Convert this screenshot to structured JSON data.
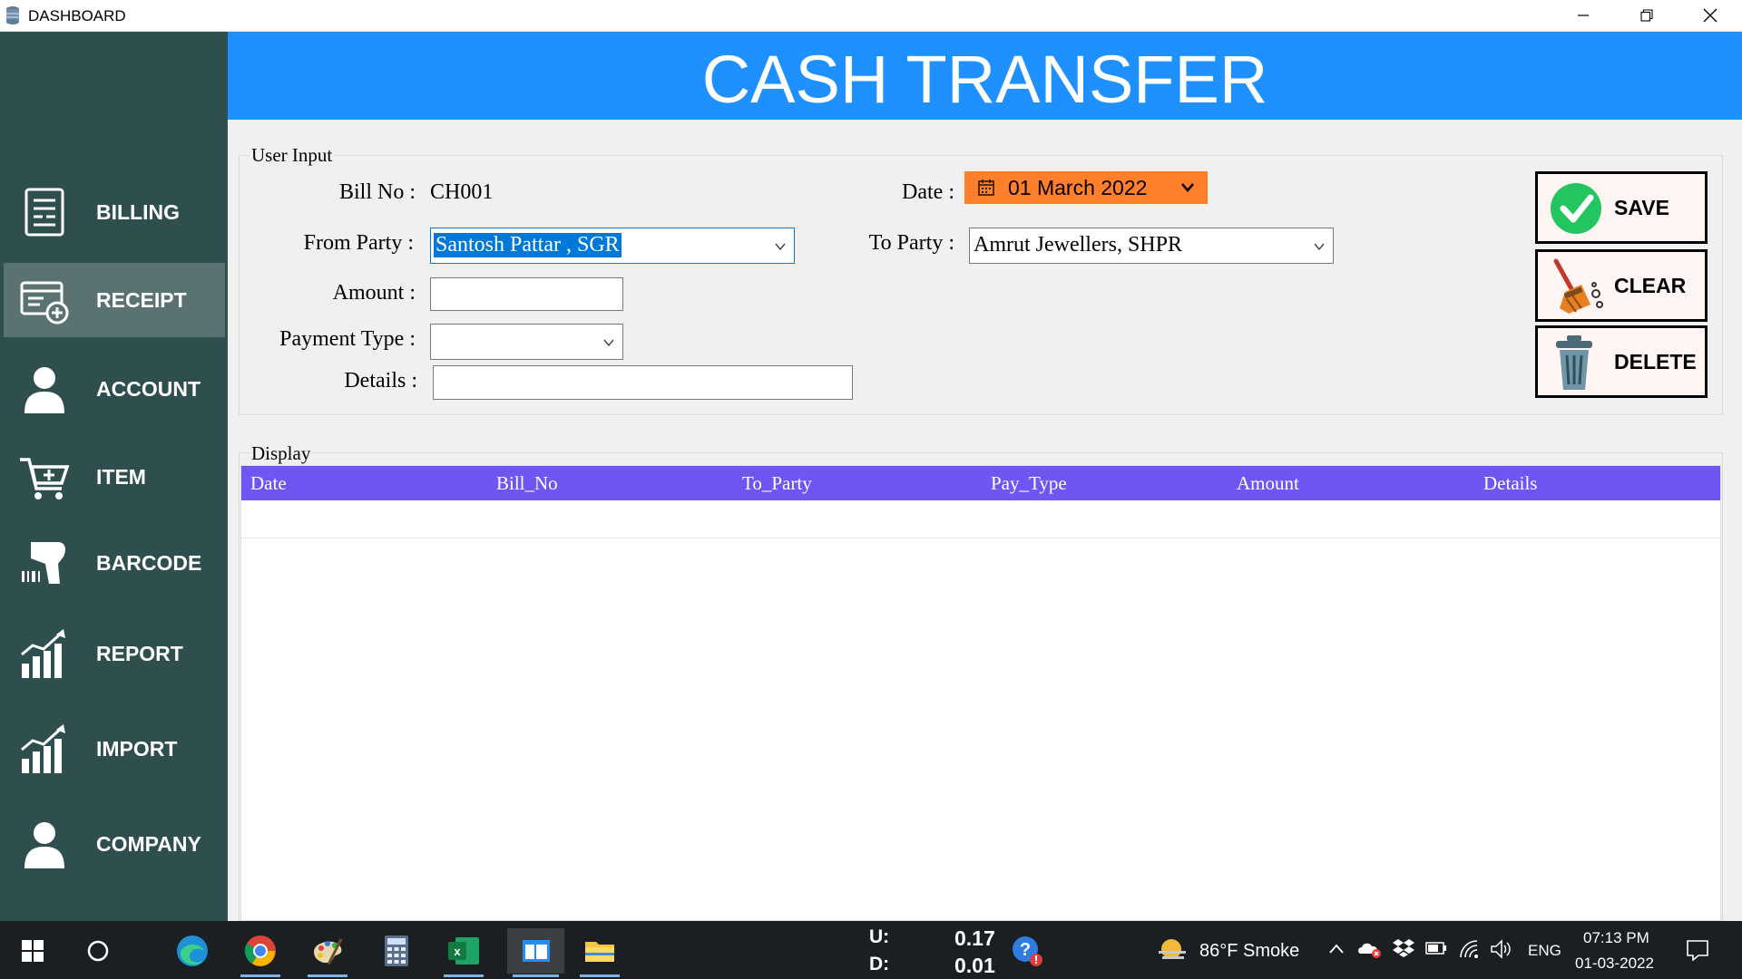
{
  "window": {
    "title": "DASHBOARD",
    "minimize_icon": "minimize-icon",
    "restore_icon": "restore-icon",
    "close_icon": "close-icon"
  },
  "sidebar": {
    "items": [
      {
        "label": "BILLING",
        "icon": "billing-icon",
        "active": false
      },
      {
        "label": "RECEIPT",
        "icon": "receipt-icon",
        "active": true
      },
      {
        "label": "ACCOUNT",
        "icon": "account-icon",
        "active": false
      },
      {
        "label": "ITEM",
        "icon": "cart-icon",
        "active": false
      },
      {
        "label": "BARCODE",
        "icon": "barcode-scanner-icon",
        "active": false
      },
      {
        "label": "REPORT",
        "icon": "report-chart-icon",
        "active": false
      },
      {
        "label": "IMPORT",
        "icon": "import-chart-icon",
        "active": false
      },
      {
        "label": "COMPANY",
        "icon": "company-icon",
        "active": false
      }
    ]
  },
  "header": {
    "title": "CASH TRANSFER"
  },
  "form": {
    "group_title": "User Input",
    "bill_no_label": "Bill No :",
    "bill_no_value": "CH001",
    "date_label": "Date :",
    "date_value": "01 March 2022",
    "from_party_label": "From Party :",
    "from_party_value": "Santosh Pattar , SGR",
    "to_party_label": "To Party :",
    "to_party_value": "Amrut Jewellers, SHPR",
    "amount_label": "Amount :",
    "amount_value": "",
    "payment_type_label": "Payment Type :",
    "payment_type_value": "",
    "details_label": "Details :",
    "details_value": ""
  },
  "actions": {
    "save_label": "SAVE",
    "clear_label": "CLEAR",
    "delete_label": "DELETE"
  },
  "display": {
    "group_title": "Display",
    "columns": [
      "Date",
      "Bill_No",
      "To_Party",
      "Pay_Type",
      "Amount",
      "Details"
    ],
    "rows": []
  },
  "taskbar": {
    "apps": [
      "windows-start-icon",
      "search-circle-icon",
      "edge-icon",
      "chrome-icon",
      "paint-icon",
      "calculator-icon",
      "excel-icon",
      "app-window-icon",
      "file-explorer-icon"
    ],
    "net_u_label": "U:",
    "net_u_value": "0.17",
    "net_d_label": "D:",
    "net_d_value": "0.01",
    "weather": "86°F  Smoke",
    "language": "ENG",
    "time": "07:13 PM",
    "date": "01-03-2022"
  },
  "colors": {
    "sidebar_bg": "#2f4f4f",
    "sidebar_active": "#5a7272",
    "banner_bg": "#1e90ff",
    "grid_header_bg": "#7055f5",
    "date_picker_bg": "#ff7f2a",
    "selection_bg": "#0078d7",
    "taskbar_bg": "#1b1f22"
  }
}
